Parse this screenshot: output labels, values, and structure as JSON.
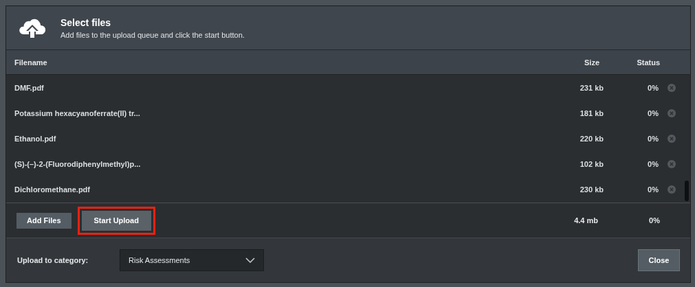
{
  "header": {
    "title": "Select files",
    "subtitle": "Add files to the upload queue and click the start button."
  },
  "table": {
    "columns": [
      "Filename",
      "Size",
      "Status"
    ],
    "rows": [
      {
        "filename": "DMF.pdf",
        "size": "231 kb",
        "status": "0%"
      },
      {
        "filename": "Potassium hexacyanoferrate(II) tr...",
        "size": "181 kb",
        "status": "0%"
      },
      {
        "filename": "Ethanol.pdf",
        "size": "220 kb",
        "status": "0%"
      },
      {
        "filename": "(S)-(–)-2-(Fluorodiphenylmethyl)p...",
        "size": "102 kb",
        "status": "0%"
      },
      {
        "filename": "Dichloromethane.pdf",
        "size": "230 kb",
        "status": "0%"
      }
    ]
  },
  "actions": [
    {
      "label": "Add Files",
      "highlighted": false
    },
    {
      "label": "Start Upload",
      "highlighted": true
    }
  ],
  "totals": {
    "size": "4.4 mb",
    "status": "0%"
  },
  "category": {
    "label": "Upload to category:",
    "value": "Risk Assessments"
  },
  "close_button": "Close"
}
